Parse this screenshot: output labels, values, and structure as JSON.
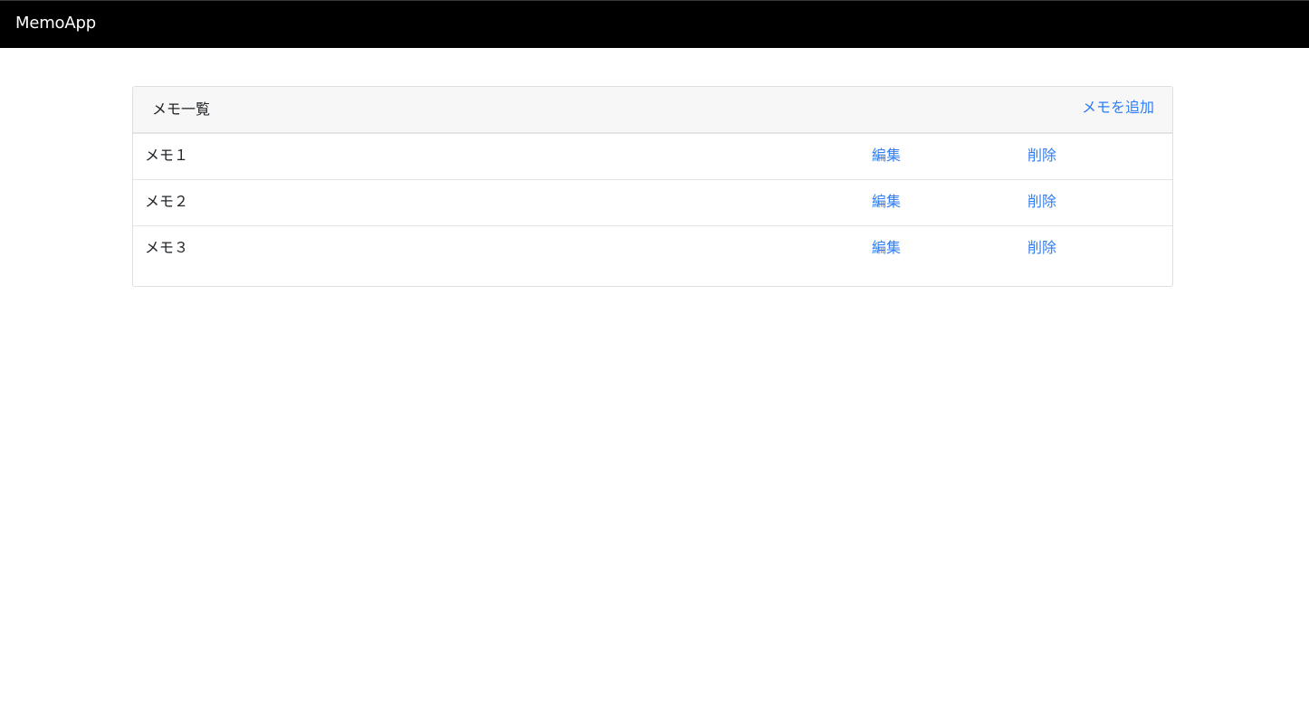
{
  "navbar": {
    "brand": "MemoApp"
  },
  "card": {
    "title": "メモ一覧",
    "add_link": "メモを追加"
  },
  "memos": [
    {
      "title": "メモ１",
      "edit_label": "編集",
      "delete_label": "削除"
    },
    {
      "title": "メモ２",
      "edit_label": "編集",
      "delete_label": "削除"
    },
    {
      "title": "メモ３",
      "edit_label": "編集",
      "delete_label": "削除"
    }
  ],
  "colors": {
    "navbar_bg": "#000000",
    "link": "#2f7df2",
    "card_header_bg": "#f7f7f7"
  }
}
